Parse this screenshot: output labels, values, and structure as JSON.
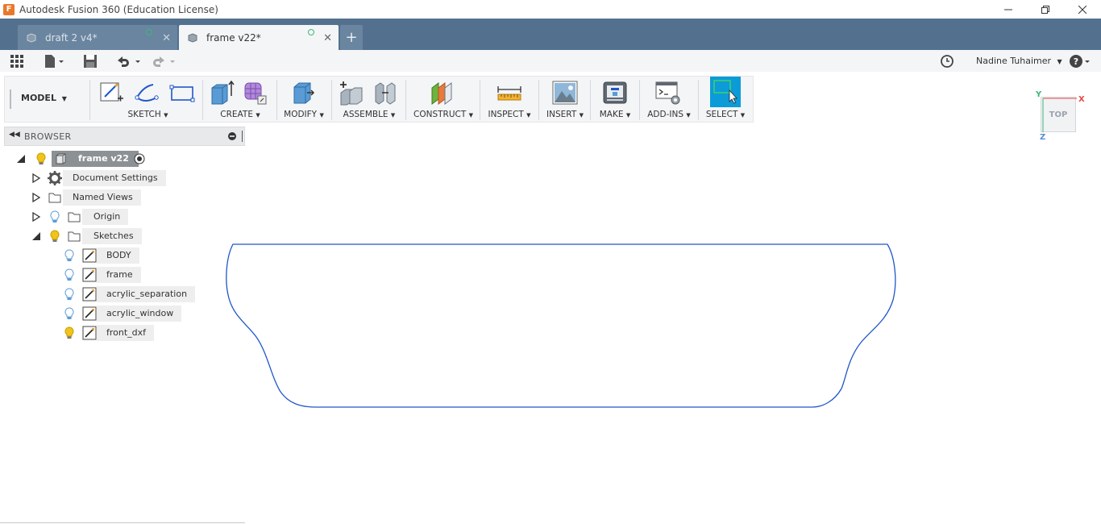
{
  "window": {
    "title": "Autodesk Fusion 360 (Education License)",
    "logo_letter": "F"
  },
  "tabs": [
    {
      "label": "draft 2 v4*",
      "active": false
    },
    {
      "label": "frame v22*",
      "active": true
    }
  ],
  "user": {
    "name": "Nadine Tuhaimer"
  },
  "toolbar": {
    "workspace": "MODEL",
    "groups": {
      "sketch": "SKETCH",
      "create": "CREATE",
      "modify": "MODIFY",
      "assemble": "ASSEMBLE",
      "construct": "CONSTRUCT",
      "inspect": "INSPECT",
      "insert": "INSERT",
      "make": "MAKE",
      "addins": "ADD-INS",
      "select": "SELECT"
    }
  },
  "browser": {
    "title": "BROWSER",
    "root": "frame v22",
    "items": {
      "document_settings": "Document Settings",
      "named_views": "Named Views",
      "origin": "Origin",
      "sketches": "Sketches"
    },
    "sketches": [
      "BODY",
      "frame",
      "acrylic_separation",
      "acrylic_window",
      "front_dxf"
    ]
  },
  "viewcube": {
    "face": "TOP",
    "axis_x": "X",
    "axis_y": "Y",
    "axis_z": "Z"
  },
  "colors": {
    "tabbar": "#53718f",
    "select_active": "#0b9bd8",
    "sketch_curve": "#1f57c8",
    "bulb_on": "#f0c419",
    "bulb_off": "#5b9bd5"
  }
}
